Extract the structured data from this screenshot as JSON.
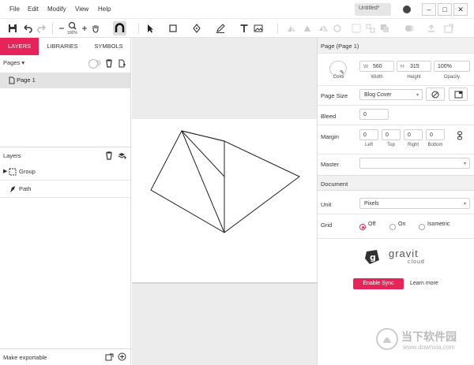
{
  "menu": [
    "File",
    "Edit",
    "Modify",
    "View",
    "Help"
  ],
  "doc_tab": "Untitled*",
  "window_buttons": [
    "–",
    "□",
    "✕"
  ],
  "toolbar": {
    "zoom": "100%"
  },
  "left_panel": {
    "tabs": [
      "LAYERS",
      "LIBRARIES",
      "SYMBOLS"
    ],
    "pages_label": "Pages",
    "pages": [
      "Page 1"
    ],
    "layers_label": "Layers",
    "layers": [
      "Group",
      "Path"
    ],
    "footer": "Make exportable"
  },
  "right_panel": {
    "title": "Page (Page 1)",
    "color_label": "Color",
    "width_prefix": "W",
    "width": "560",
    "width_label": "Width",
    "height_prefix": "H",
    "height": "315",
    "height_label": "Height",
    "opacity": "100%",
    "opacity_label": "Opacity",
    "page_size_label": "Page Size",
    "page_size": "Blog Cover",
    "bleed_label": "Bleed",
    "bleed": "0",
    "margin_label": "Margin",
    "margins": [
      {
        "value": "0",
        "label": "Left"
      },
      {
        "value": "0",
        "label": "Top"
      },
      {
        "value": "0",
        "label": "Right"
      },
      {
        "value": "0",
        "label": "Bottom"
      }
    ],
    "master_label": "Master",
    "master": "",
    "document_label": "Document",
    "unit_label": "Unit",
    "unit": "Pixels",
    "grid_label": "Grid",
    "grid_options": [
      "Off",
      "On",
      "Isometric"
    ],
    "grid_selected": "Off",
    "brand": "gravit",
    "brand_sub": "cloud",
    "sync_button": "Enable Sync",
    "learn_more": "Learn more"
  },
  "watermark": {
    "text": "当下软件园",
    "url": "www.downxia.com"
  },
  "colors": {
    "accent": "#e6245a"
  }
}
